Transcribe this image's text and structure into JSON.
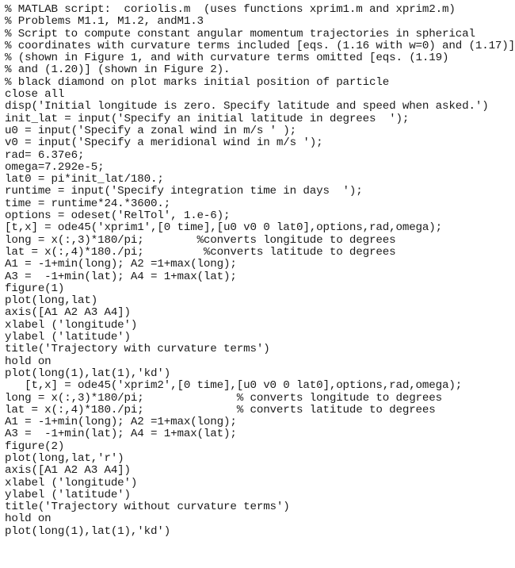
{
  "document": {
    "kind": "matlab-script-listing",
    "filename": "coriolis.m",
    "background_color": "#ffffff",
    "text_color": "#1a1a1a",
    "lines": [
      "% MATLAB script:  coriolis.m  (uses functions xprim1.m and xprim2.m)",
      "% Problems M1.1, M1.2, andM1.3",
      "% Script to compute constant angular momentum trajectories in spherical",
      "% coordinates with curvature terms included [eqs. (1.16 with w=0) and (1.17)]",
      "% (shown in Figure 1, and with curvature terms omitted [eqs. (1.19)",
      "% and (1.20)] (shown in Figure 2).",
      "% black diamond on plot marks initial position of particle",
      "close all",
      "disp('Initial longitude is zero. Specify latitude and speed when asked.')",
      "init_lat = input('Specify an initial latitude in degrees  ');",
      "u0 = input('Specify a zonal wind in m/s ' );",
      "v0 = input('Specify a meridional wind in m/s ');",
      "rad= 6.37e6;",
      "omega=7.292e-5;",
      "lat0 = pi*init_lat/180.;",
      "runtime = input('Specify integration time in days  ');",
      "time = runtime*24.*3600.;",
      "options = odeset('RelTol', 1.e-6);",
      "[t,x] = ode45('xprim1',[0 time],[u0 v0 0 lat0],options,rad,omega);",
      "long = x(:,3)*180/pi;        %converts longitude to degrees",
      "lat = x(:,4)*180./pi;         %converts latitude to degrees",
      "A1 = -1+min(long); A2 =1+max(long);",
      "A3 =  -1+min(lat); A4 = 1+max(lat);",
      "figure(1)",
      "plot(long,lat)",
      "axis([A1 A2 A3 A4])",
      "xlabel ('longitude')",
      "ylabel ('latitude')",
      "title('Trajectory with curvature terms')",
      "hold on",
      "plot(long(1),lat(1),'kd')",
      "   [t,x] = ode45('xprim2',[0 time],[u0 v0 0 lat0],options,rad,omega);",
      "long = x(:,3)*180/pi;              % converts longitude to degrees",
      "lat = x(:,4)*180./pi;              % converts latitude to degrees",
      "A1 = -1+min(long); A2 =1+max(long);",
      "A3 =  -1+min(lat); A4 = 1+max(lat);",
      "figure(2)",
      "plot(long,lat,'r')",
      "axis([A1 A2 A3 A4])",
      "xlabel ('longitude')",
      "ylabel ('latitude')",
      "title('Trajectory without curvature terms')",
      "hold on",
      "plot(long(1),lat(1),'kd')"
    ]
  }
}
